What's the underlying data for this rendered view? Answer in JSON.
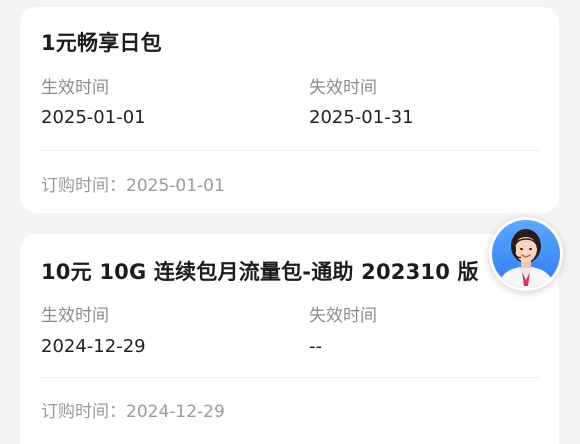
{
  "packages": [
    {
      "title": "1元畅享日包",
      "effective_label": "生效时间",
      "effective_value": "2025-01-01",
      "expiry_label": "失效时间",
      "expiry_value": "2025-01-31",
      "order_text": "订购时间：2025-01-01"
    },
    {
      "title": "10元 10G 连续包月流量包-通助 202310 版",
      "effective_label": "生效时间",
      "effective_value": "2024-12-29",
      "expiry_label": "失效时间",
      "expiry_value": "--",
      "order_text": "订购时间：2024-12-29"
    }
  ],
  "assistant": {
    "icon": "customer-service-avatar-icon",
    "accent": "#2d7cf6"
  }
}
